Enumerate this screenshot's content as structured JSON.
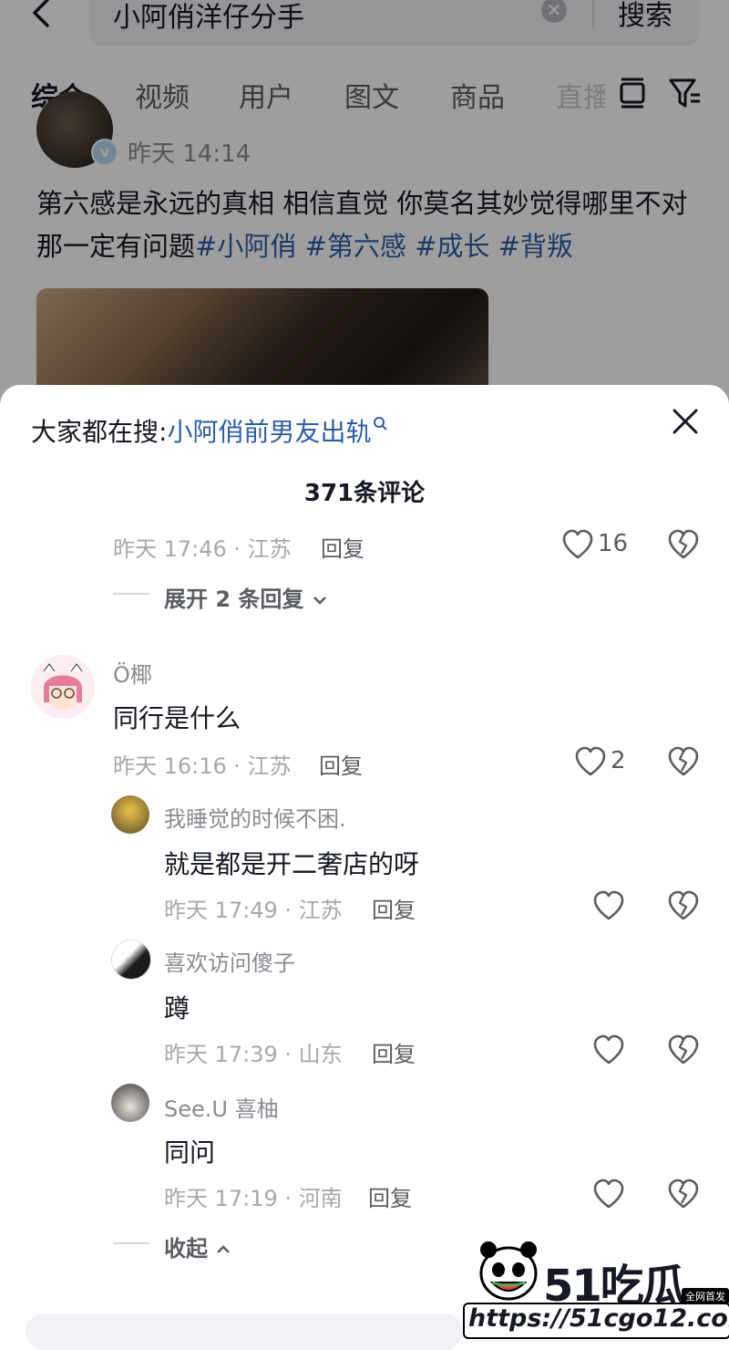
{
  "search": {
    "query": "小阿俏洋仔分手",
    "button_label": "搜索"
  },
  "tabs": [
    {
      "label": "综合"
    },
    {
      "label": "视频"
    },
    {
      "label": "用户"
    },
    {
      "label": "图文"
    },
    {
      "label": "商品"
    },
    {
      "label": "直播"
    }
  ],
  "post": {
    "time": "昨天 14:14",
    "text_plain": "第六感是永远的真相 相信直觉 你莫名其妙觉得哪里不对那一定有问题",
    "hashtags": [
      "#小阿俏",
      "#第六感",
      "#成长",
      "#背叛"
    ]
  },
  "sheet": {
    "hot_search_prefix": "大家都在搜:",
    "hot_search_term": "小阿俏前男友出轨",
    "comment_count": "371条评论",
    "top_comment_meta": {
      "time_location": "昨天 17:46 · 江苏",
      "reply": "回复",
      "likes": "16"
    },
    "expand_replies": "展开 2 条回复",
    "comment": {
      "username": "Ö椰",
      "text": "同行是什么",
      "time_location": "昨天 16:16 · 江苏",
      "reply": "回复",
      "likes": "2"
    },
    "replies": [
      {
        "username": "我睡觉的时候不困.",
        "text": "就是都是开二奢店的呀",
        "time_location": "昨天 17:49 · 江苏",
        "reply": "回复"
      },
      {
        "username": "喜欢访问傻子",
        "text": "蹲",
        "time_location": "昨天 17:39 · 山东",
        "reply": "回复"
      },
      {
        "username": "See.U 喜柚",
        "text": "同问",
        "time_location": "昨天 17:19 · 河南",
        "reply": "回复"
      }
    ],
    "collapse": "收起"
  },
  "watermark": {
    "logo_text": "51吃瓜",
    "badge": "全网首发",
    "url": "https://51cgo12.com"
  },
  "colors": {
    "link_blue": "#2c5ea6",
    "text_primary": "#161823",
    "text_secondary": "#a7a8ad"
  }
}
